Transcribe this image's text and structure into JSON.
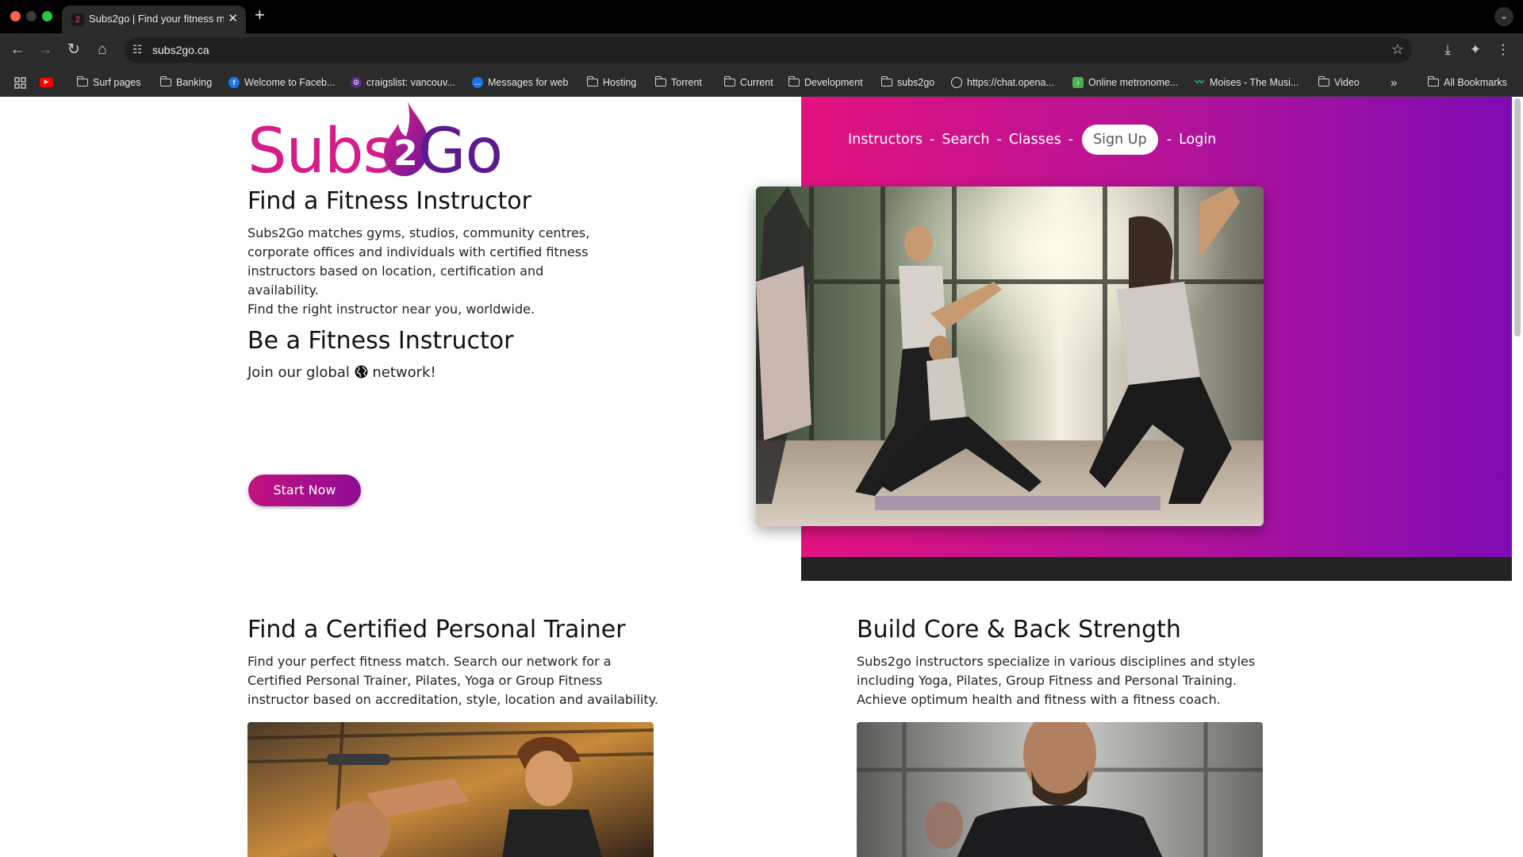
{
  "browser": {
    "tab_title": "Subs2go | Find your fitness m",
    "tab_favicon": "2",
    "url": "subs2go.ca",
    "bookmarks": [
      {
        "icon": "youtube-icon",
        "label": ""
      },
      {
        "icon": "folder-icon",
        "label": "Surf pages"
      },
      {
        "icon": "folder-icon",
        "label": "Banking"
      },
      {
        "icon": "facebook-icon",
        "label": "Welcome to Faceb..."
      },
      {
        "icon": "craigslist-icon",
        "label": "craigslist: vancouv..."
      },
      {
        "icon": "messages-icon",
        "label": "Messages for web"
      },
      {
        "icon": "folder-icon",
        "label": "Hosting"
      },
      {
        "icon": "folder-icon",
        "label": "Torrent"
      },
      {
        "icon": "folder-icon",
        "label": "Current"
      },
      {
        "icon": "folder-icon",
        "label": "Development"
      },
      {
        "icon": "folder-icon",
        "label": "subs2go"
      },
      {
        "icon": "openai-icon",
        "label": "https://chat.opena..."
      },
      {
        "icon": "metronome-icon",
        "label": "Online metronome..."
      },
      {
        "icon": "moises-icon",
        "label": "Moises - The Musi..."
      },
      {
        "icon": "folder-icon",
        "label": "Video"
      }
    ],
    "all_bookmarks": "All Bookmarks",
    "overflow": "»"
  },
  "site": {
    "logo": {
      "left": "Subs",
      "mid": "2",
      "right": "Go"
    },
    "nav": {
      "instructors": "Instructors",
      "search": "Search",
      "classes": "Classes",
      "signup": "Sign Up",
      "login": "Login",
      "sep": "-"
    },
    "find": {
      "heading": "Find a Fitness Instructor",
      "p1": "Subs2Go matches gyms, studios, community centres, corporate offices and individuals with certified fitness instructors based on location, certification and availability.",
      "p2": "Find the right instructor near you, worldwide."
    },
    "be": {
      "heading": "Be a Fitness Instructor",
      "join_pre": "Join our global",
      "join_post": "network!",
      "button": "Start Now"
    },
    "trainer": {
      "heading": "Find a Certified Personal Trainer",
      "p": "Find your perfect fitness match. Search our network for a Certified Personal Trainer, Pilates, Yoga or Group Fitness instructor based on accreditation, style, location and availability."
    },
    "core": {
      "heading": "Build Core & Back Strength",
      "p": "Subs2go instructors specialize in various disciplines and styles including Yoga, Pilates, Group Fitness and Personal Training. Achieve optimum health and fitness with a fitness coach."
    }
  },
  "colors": {
    "brand_pink": "#d81b8a",
    "brand_purple": "#5d1a8e",
    "hero_gradient_start": "#e3127f",
    "hero_gradient_end": "#7f0bb4"
  }
}
